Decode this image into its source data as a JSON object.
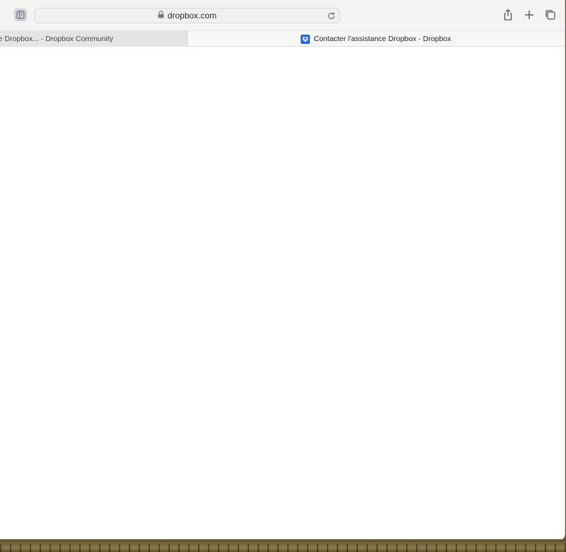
{
  "browser": {
    "address_bar": {
      "url": "dropbox.com"
    },
    "tabs": [
      {
        "label": "nce Dropbox... - Dropbox Community",
        "active": false
      },
      {
        "label": "Contacter l'assistance Dropbox - Dropbox",
        "active": true,
        "favicon": "dropbox-icon"
      }
    ],
    "icons": {
      "sidebar": "sidebar-icon",
      "lock": "lock-icon",
      "reload": "reload-icon",
      "share": "share-icon",
      "new_tab": "plus-icon",
      "tab_overview": "tab-overview-icon"
    }
  },
  "colors": {
    "dropbox_blue": "#1a65f5",
    "toolbar_bg": "#f4f4f3",
    "page_bg": "#ffffff"
  }
}
